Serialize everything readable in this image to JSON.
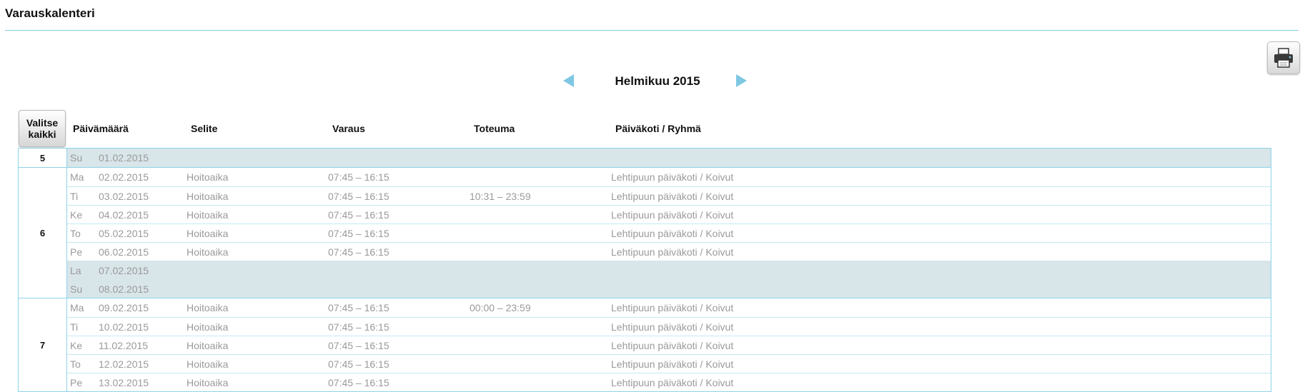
{
  "page": {
    "title": "Varauskalenteri"
  },
  "toolbar": {
    "print_icon": "printer-icon"
  },
  "nav": {
    "month_label": "Helmikuu 2015",
    "prev_icon": "arrow-left-icon",
    "next_icon": "arrow-right-icon"
  },
  "table": {
    "select_all_label": "Valitse\nkaikki",
    "headers": {
      "date": "Päivämäärä",
      "description": "Selite",
      "reservation": "Varaus",
      "actual": "Toteuma",
      "daycare": "Päiväkoti / Ryhmä"
    },
    "weeks": [
      {
        "week": "5",
        "days": [
          {
            "weekday": "Su",
            "date": "01.02.2015",
            "description": "",
            "reservation": "",
            "actual": "",
            "daycare": "",
            "weekend": true
          }
        ]
      },
      {
        "week": "6",
        "days": [
          {
            "weekday": "Ma",
            "date": "02.02.2015",
            "description": "Hoitoaika",
            "reservation": "07:45  –  16:15",
            "actual": "",
            "daycare": "Lehtipuun päiväkoti / Koivut",
            "weekend": false
          },
          {
            "weekday": "Ti",
            "date": "03.02.2015",
            "description": "Hoitoaika",
            "reservation": "07:45  –  16:15",
            "actual": "10:31 – 23:59",
            "daycare": "Lehtipuun päiväkoti / Koivut",
            "weekend": false
          },
          {
            "weekday": "Ke",
            "date": "04.02.2015",
            "description": "Hoitoaika",
            "reservation": "07:45  –  16:15",
            "actual": "",
            "daycare": "Lehtipuun päiväkoti / Koivut",
            "weekend": false
          },
          {
            "weekday": "To",
            "date": "05.02.2015",
            "description": "Hoitoaika",
            "reservation": "07:45  –  16:15",
            "actual": "",
            "daycare": "Lehtipuun päiväkoti / Koivut",
            "weekend": false
          },
          {
            "weekday": "Pe",
            "date": "06.02.2015",
            "description": "Hoitoaika",
            "reservation": "07:45  –  16:15",
            "actual": "",
            "daycare": "Lehtipuun päiväkoti / Koivut",
            "weekend": false
          },
          {
            "weekday": "La",
            "date": "07.02.2015",
            "description": "",
            "reservation": "",
            "actual": "",
            "daycare": "",
            "weekend": true
          },
          {
            "weekday": "Su",
            "date": "08.02.2015",
            "description": "",
            "reservation": "",
            "actual": "",
            "daycare": "",
            "weekend": true
          }
        ]
      },
      {
        "week": "7",
        "days": [
          {
            "weekday": "Ma",
            "date": "09.02.2015",
            "description": "Hoitoaika",
            "reservation": "07:45  –  16:15",
            "actual": "00:00 – 23:59",
            "daycare": "Lehtipuun päiväkoti / Koivut",
            "weekend": false
          },
          {
            "weekday": "Ti",
            "date": "10.02.2015",
            "description": "Hoitoaika",
            "reservation": "07:45  –  16:15",
            "actual": "",
            "daycare": "Lehtipuun päiväkoti / Koivut",
            "weekend": false
          },
          {
            "weekday": "Ke",
            "date": "11.02.2015",
            "description": "Hoitoaika",
            "reservation": "07:45  –  16:15",
            "actual": "",
            "daycare": "Lehtipuun päiväkoti / Koivut",
            "weekend": false
          },
          {
            "weekday": "To",
            "date": "12.02.2015",
            "description": "Hoitoaika",
            "reservation": "07:45  –  16:15",
            "actual": "",
            "daycare": "Lehtipuun päiväkoti / Koivut",
            "weekend": false
          },
          {
            "weekday": "Pe",
            "date": "13.02.2015",
            "description": "Hoitoaika",
            "reservation": "07:45  –  16:15",
            "actual": "",
            "daycare": "Lehtipuun päiväkoti / Koivut",
            "weekend": false
          }
        ]
      }
    ]
  }
}
